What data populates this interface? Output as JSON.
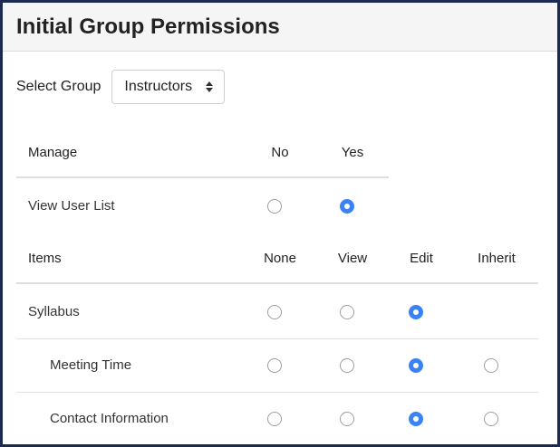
{
  "title": "Initial Group Permissions",
  "group_select": {
    "label": "Select Group",
    "value": "Instructors",
    "icon": "up-down-caret-icon"
  },
  "manage": {
    "header": "Manage",
    "columns": [
      "No",
      "Yes"
    ],
    "rows": [
      {
        "label": "View User List",
        "selected": "Yes"
      }
    ]
  },
  "items": {
    "header": "Items",
    "columns": [
      "None",
      "View",
      "Edit",
      "Inherit"
    ],
    "rows": [
      {
        "label": "Syllabus",
        "selected": "Edit",
        "has_inherit": false
      },
      {
        "label": "Meeting Time",
        "selected": "Edit",
        "has_inherit": true
      },
      {
        "label": "Contact Information",
        "selected": "Edit",
        "has_inherit": true
      }
    ]
  },
  "colors": {
    "accent": "#3b82f6",
    "frame": "#1c2a52",
    "header_bg": "#f5f5f5"
  }
}
